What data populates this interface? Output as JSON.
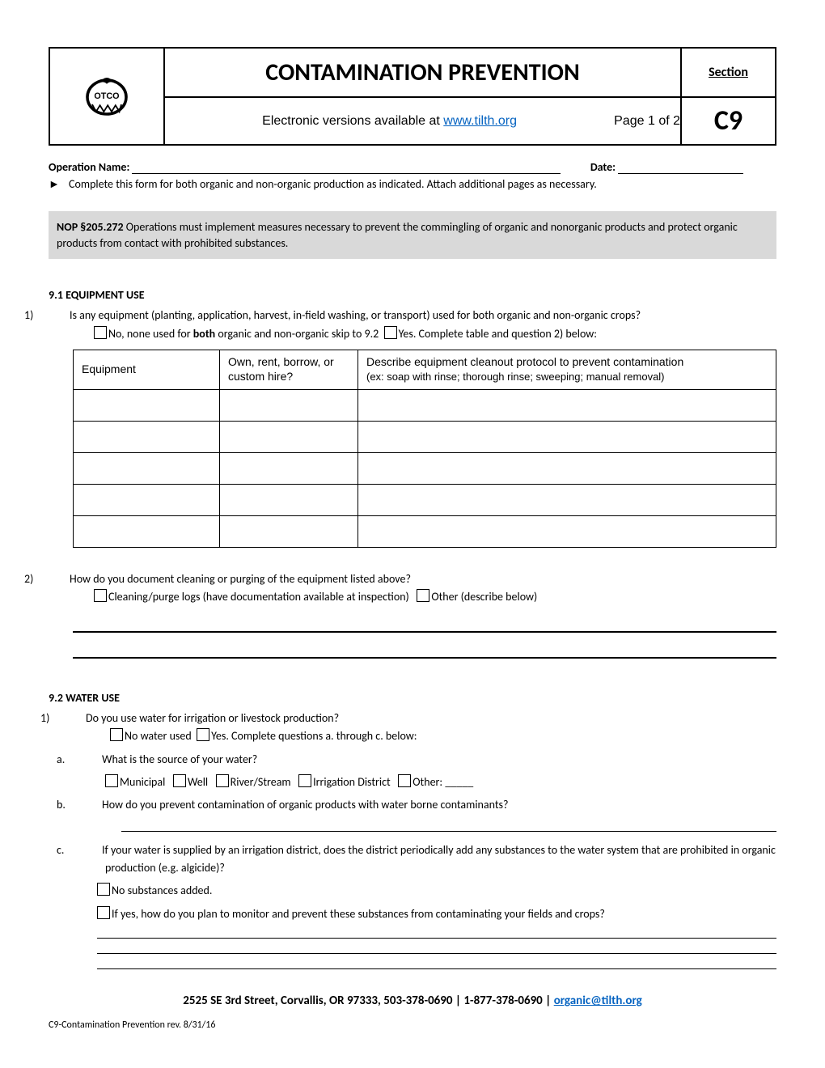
{
  "header": {
    "title": "CONTAMINATION PREVENTION",
    "section_label": "Section",
    "section_code": "C9",
    "subtitle_pre": "Electronic versions available at ",
    "subtitle_link": "www.tilth.org",
    "page_label": "Page 1 of 2"
  },
  "fields": {
    "operation_name_label": "Operation Name:",
    "date_label": "Date:"
  },
  "instruction": {
    "arrow": "►",
    "text": "Complete this form for both organic and non-organic production as indicated. Attach additional pages as necessary."
  },
  "nop": {
    "bold": "NOP §205.272",
    "text": " Operations must implement measures necessary to prevent the commingling of organic and nonorganic products and protect organic products from contact with prohibited substances."
  },
  "s91": {
    "num": "9.1",
    "title": "EQUIPMENT USE",
    "q1_num": "1)",
    "q1": "Is any equipment (planting, application, harvest, in-field washing, or transport) used for both organic and non-organic crops?",
    "no_pre": "No, none used for ",
    "no_bold": "both",
    "no_post": " organic and non-organic skip to 9.2",
    "yes": "Yes. Complete table and question 2) below:",
    "table": {
      "h1": "Equipment",
      "h2": "Own, rent, borrow, or custom hire?",
      "h3a": "Describe equipment cleanout protocol to prevent contamination",
      "h3b": "(ex: soap with rinse; thorough rinse; sweeping; manual removal)"
    },
    "q2_num": "2)",
    "q2": "How do you document cleaning or purging of the equipment listed above?",
    "q2_opt1": "Cleaning/purge logs (have documentation available at inspection)",
    "q2_opt2": "Other (describe below)"
  },
  "s92": {
    "num": "9.2",
    "title": "WATER USE",
    "q1_num": "1)",
    "q1": "Do you use water for irrigation or livestock production?",
    "no": "No water used",
    "yes": "Yes. Complete questions a. through c. below:",
    "a_num": "a.",
    "a": "What is the source of your water?",
    "a_opts": [
      "Municipal",
      "Well",
      "River/Stream",
      "Irrigation District",
      "Other: _____"
    ],
    "b_num": "b.",
    "b": "How do you prevent contamination of organic products with water borne contaminants?",
    "c_num": "c.",
    "c": "If your water is supplied by an irrigation district, does the district periodically add any substances to the water system that are prohibited in organic production (e.g. algicide)?",
    "c_no": "No substances added.",
    "c_yes": "If yes, how do you plan to monitor and prevent these substances from contaminating your fields and crops?"
  },
  "footer": {
    "address": "2525 SE 3rd Street, Corvallis, OR 97333, 503-378-0690 | 1-877-378-0690 | ",
    "email": "organic@tilth.org",
    "rev": "C9-Contamination Prevention rev. 8/31/16"
  }
}
